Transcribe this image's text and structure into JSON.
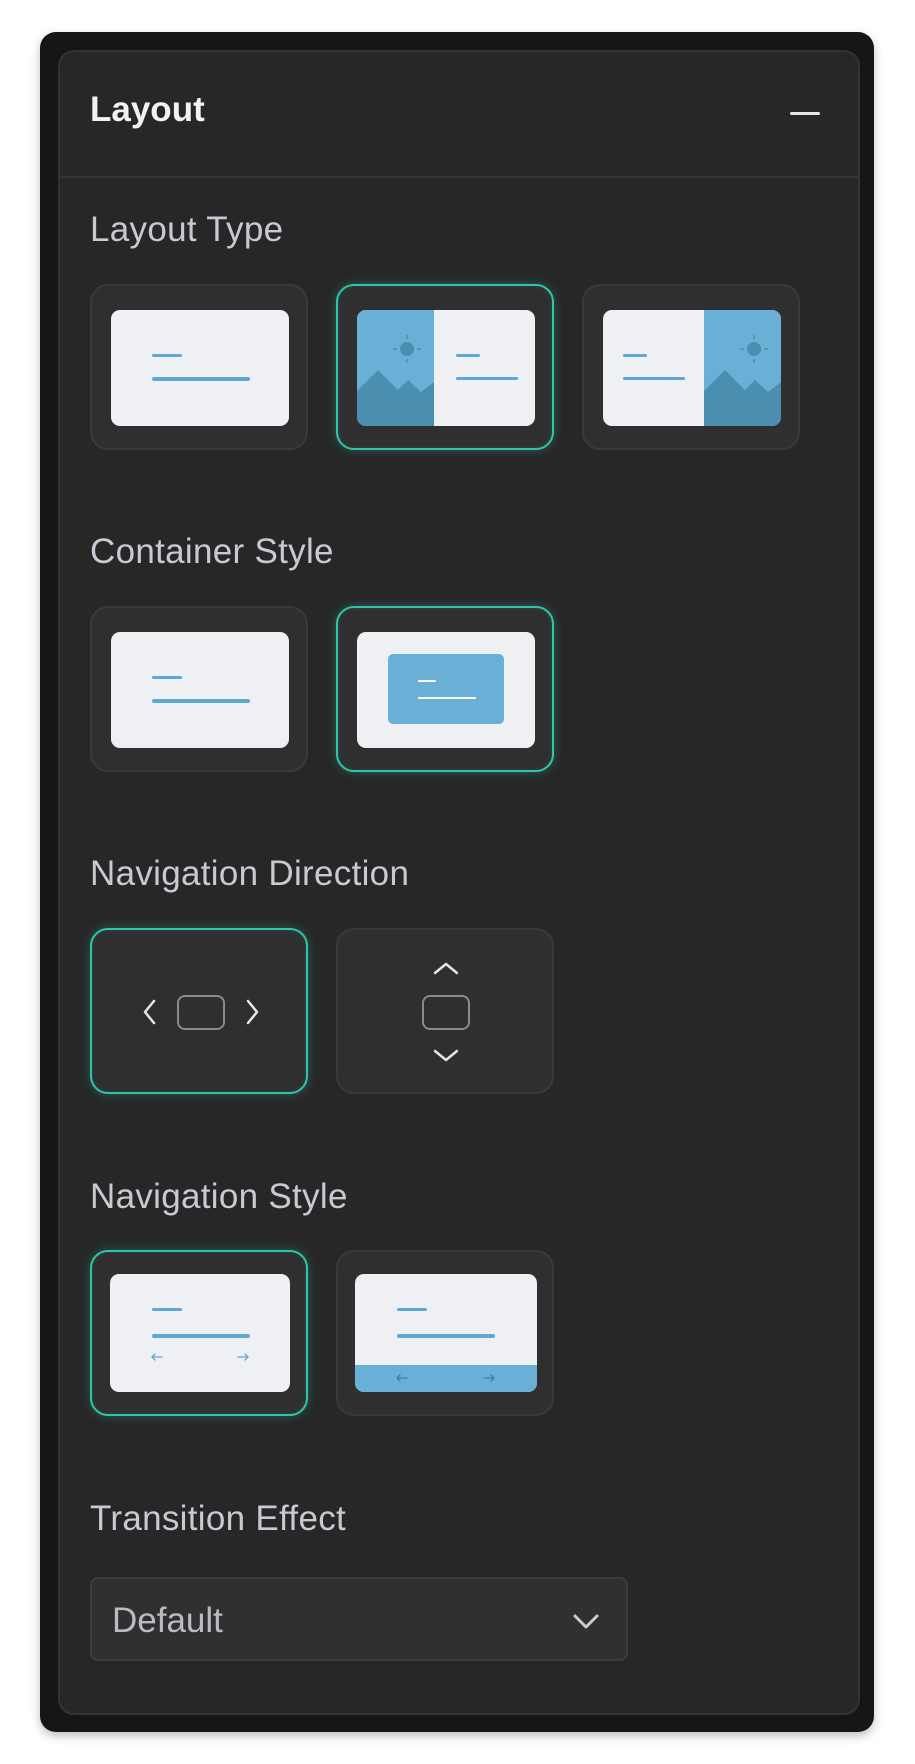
{
  "panel": {
    "title": "Layout"
  },
  "sections": {
    "layout_type": {
      "label": "Layout Type"
    },
    "container_style": {
      "label": "Container Style"
    },
    "navigation_direction": {
      "label": "Navigation Direction"
    },
    "navigation_style": {
      "label": "Navigation Style"
    },
    "transition_effect": {
      "label": "Transition Effect",
      "selected": "Default"
    }
  },
  "colors": {
    "accent": "#2fc6a6",
    "panel": "#272727",
    "thumb": "#eef0f4",
    "image": "#6ab0d6"
  },
  "icons": [
    "collapse-icon",
    "chevron-left-icon",
    "chevron-right-icon",
    "chevron-up-icon",
    "chevron-down-icon",
    "sun-icon",
    "mountain-icon",
    "arrow-left-icon",
    "arrow-right-icon"
  ]
}
